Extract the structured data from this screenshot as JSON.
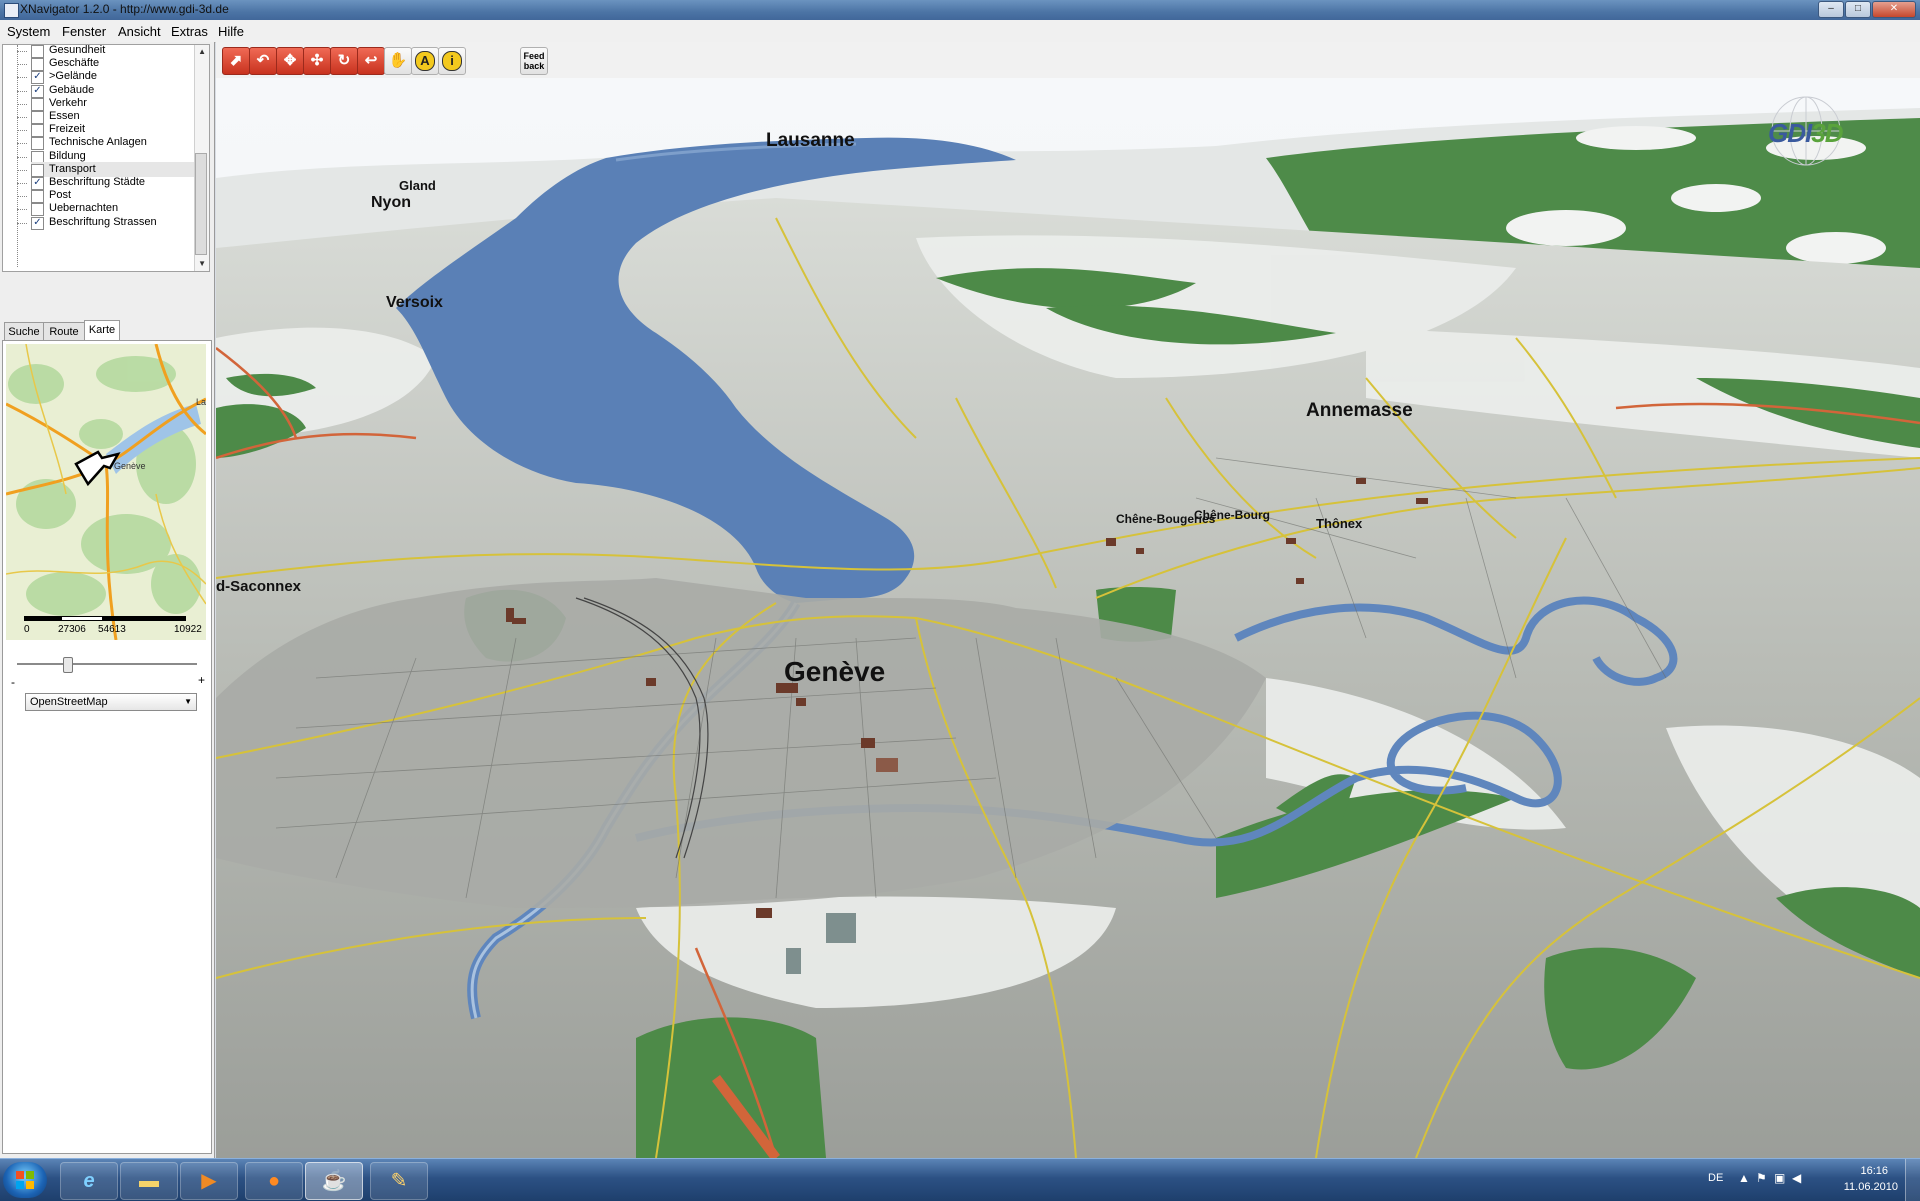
{
  "window": {
    "title": "XNavigator 1.2.0 - http://www.gdi-3d.de",
    "minimize": "–",
    "maximize": "□",
    "close": "✕"
  },
  "menu": [
    "System",
    "Fenster",
    "Ansicht",
    "Extras",
    "Hilfe"
  ],
  "layers": [
    {
      "label": "Gesundheit",
      "checked": false
    },
    {
      "label": "Geschäfte",
      "checked": false
    },
    {
      "label": ">Gelände",
      "checked": true
    },
    {
      "label": "Gebäude",
      "checked": true
    },
    {
      "label": "Verkehr",
      "checked": false
    },
    {
      "label": "Essen",
      "checked": false
    },
    {
      "label": "Freizeit",
      "checked": false
    },
    {
      "label": "Technische Anlagen",
      "checked": false
    },
    {
      "label": "Bildung",
      "checked": false
    },
    {
      "label": "Transport",
      "checked": false
    },
    {
      "label": "Beschriftung Städte",
      "checked": true
    },
    {
      "label": "Post",
      "checked": false
    },
    {
      "label": "Uebernachten",
      "checked": false
    },
    {
      "label": "Beschriftung Strassen",
      "checked": true
    }
  ],
  "tabs": [
    "Suche",
    "Route",
    "Karte"
  ],
  "active_tab": "Karte",
  "minimap": {
    "city_label": "Genève",
    "edge_label": "La",
    "scale_labels": [
      "0",
      "27306",
      "54613",
      "10922"
    ]
  },
  "zoom": {
    "minus": "-",
    "plus": "+"
  },
  "map_source": "OpenStreetMap",
  "toolbar": {
    "buttons": [
      {
        "name": "rotate-view-button",
        "glyph": "⬈",
        "style": "red"
      },
      {
        "name": "tilt-view-button",
        "glyph": "↶",
        "style": "red"
      },
      {
        "name": "move-up-down-button",
        "glyph": "✥",
        "style": "red"
      },
      {
        "name": "pan-button",
        "glyph": "✣",
        "style": "red"
      },
      {
        "name": "orbit-button",
        "glyph": "↻",
        "style": "red"
      },
      {
        "name": "undo-view-button",
        "glyph": "↩",
        "style": "red"
      },
      {
        "name": "hand-drag-button",
        "glyph": "✋",
        "style": "plain"
      },
      {
        "name": "annotation-button",
        "glyph": "A",
        "style": "plain"
      },
      {
        "name": "info-button",
        "glyph": "i",
        "style": "plain"
      }
    ],
    "feedback_label": "Feed back"
  },
  "scene": {
    "logo": "GDI3D",
    "places": {
      "lausanne": "Lausanne",
      "gland": "Gland",
      "nyon": "Nyon",
      "versoix": "Versoix",
      "annemasse": "Annemasse",
      "chene_bougeries": "Chêne-Bougeries",
      "chene_bourg": "Chêne-Bourg",
      "thonex": "Thônex",
      "saconnex": "d-Saconnex",
      "geneve": "Genève"
    }
  },
  "colors": {
    "lake": "#5b80b5",
    "forest": "#4d8a48",
    "urban": "#a9aca7",
    "roads": "#d6c23a",
    "highway": "#d2653a"
  },
  "taskbar": {
    "apps": [
      "internet-explorer",
      "explorer",
      "media-player",
      "firefox",
      "java",
      "paint"
    ],
    "language": "DE",
    "time": "16:16",
    "date": "11.06.2010"
  }
}
